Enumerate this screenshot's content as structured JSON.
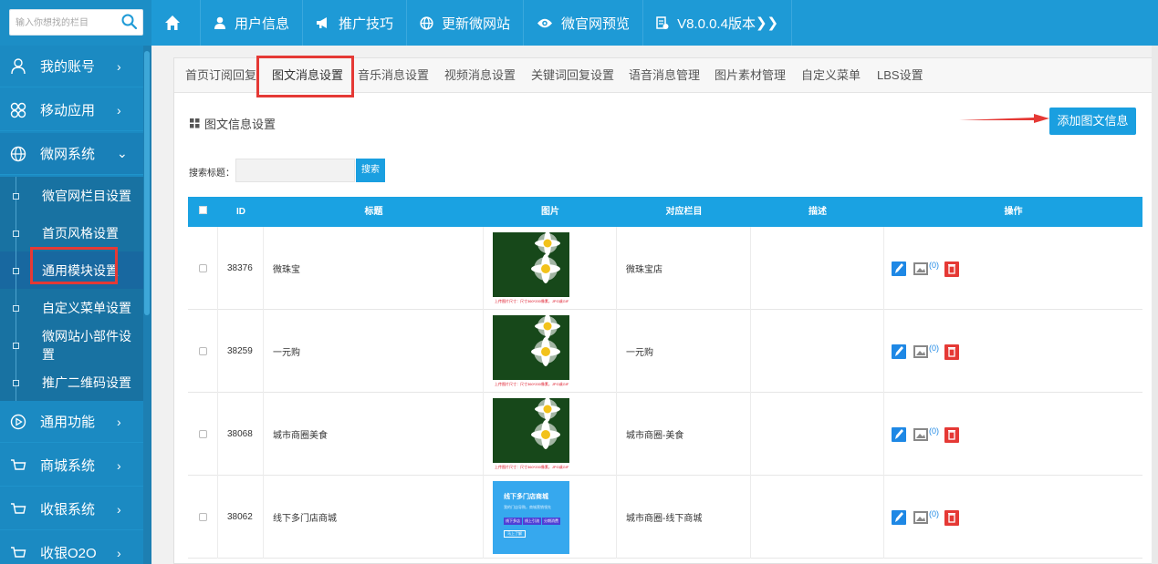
{
  "topbar": {
    "search_placeholder": "输入你想找的栏目",
    "nav": [
      "用户信息",
      "推广技巧",
      "更新微网站",
      "微官网预览",
      "V8.0.0.4版本"
    ],
    "version_suffix": "❯❯"
  },
  "sidebar": {
    "items": [
      {
        "label": "我的账号",
        "arrow": "›"
      },
      {
        "label": "移动应用",
        "arrow": "›"
      },
      {
        "label": "微网系统",
        "arrow": "⌄"
      },
      {
        "label": "通用功能",
        "arrow": "›"
      },
      {
        "label": "商城系统",
        "arrow": "›"
      },
      {
        "label": "收银系统",
        "arrow": "›"
      },
      {
        "label": "收银O2O",
        "arrow": "›"
      }
    ],
    "subitems": [
      "微官网栏目设置",
      "首页风格设置",
      "通用模块设置",
      "自定义菜单设置",
      "微网站小部件设置",
      "推广二维码设置"
    ]
  },
  "tabs": [
    "首页订阅回复",
    "图文消息设置",
    "音乐消息设置",
    "视频消息设置",
    "关键词回复设置",
    "语音消息管理",
    "图片素材管理",
    "自定义菜单",
    "LBS设置"
  ],
  "section_title": "图文信息设置",
  "add_button": "添加图文信息",
  "search": {
    "label": "搜索标题：",
    "button": "搜索"
  },
  "table": {
    "headers": [
      "ID",
      "标题",
      "图片",
      "对应栏目",
      "描述",
      "操作"
    ],
    "rows": [
      {
        "id": "38376",
        "title": "微珠宝",
        "column": "微珠宝店",
        "desc": "",
        "image": "flower",
        "count": "(0)"
      },
      {
        "id": "38259",
        "title": "一元购",
        "column": "一元购",
        "desc": "",
        "image": "flower",
        "count": "(0)"
      },
      {
        "id": "38068",
        "title": "城市商圈美食",
        "column": "城市商圈-美食",
        "desc": "",
        "image": "flower",
        "count": "(0)"
      },
      {
        "id": "38062",
        "title": "线下多门店商城",
        "column": "城市商圈-线下商城",
        "desc": "",
        "image": "promo",
        "count": "(0)"
      }
    ],
    "flower_caption": "上传图片尺寸：尺寸360*200像素，JPG或GIF",
    "promo": {
      "title": "线下多门店商城",
      "subtitle": "我的门店导购，商城营销领先",
      "buttons": [
        "线下多店",
        "线上引流",
        "分期消费"
      ],
      "cta": "马上了解"
    }
  },
  "colors": {
    "accent": "#1e9ad6",
    "sidebar": "#1b8ac2",
    "header": "#1aa2e2",
    "highlight": "#e53935",
    "delete": "#e53935"
  }
}
